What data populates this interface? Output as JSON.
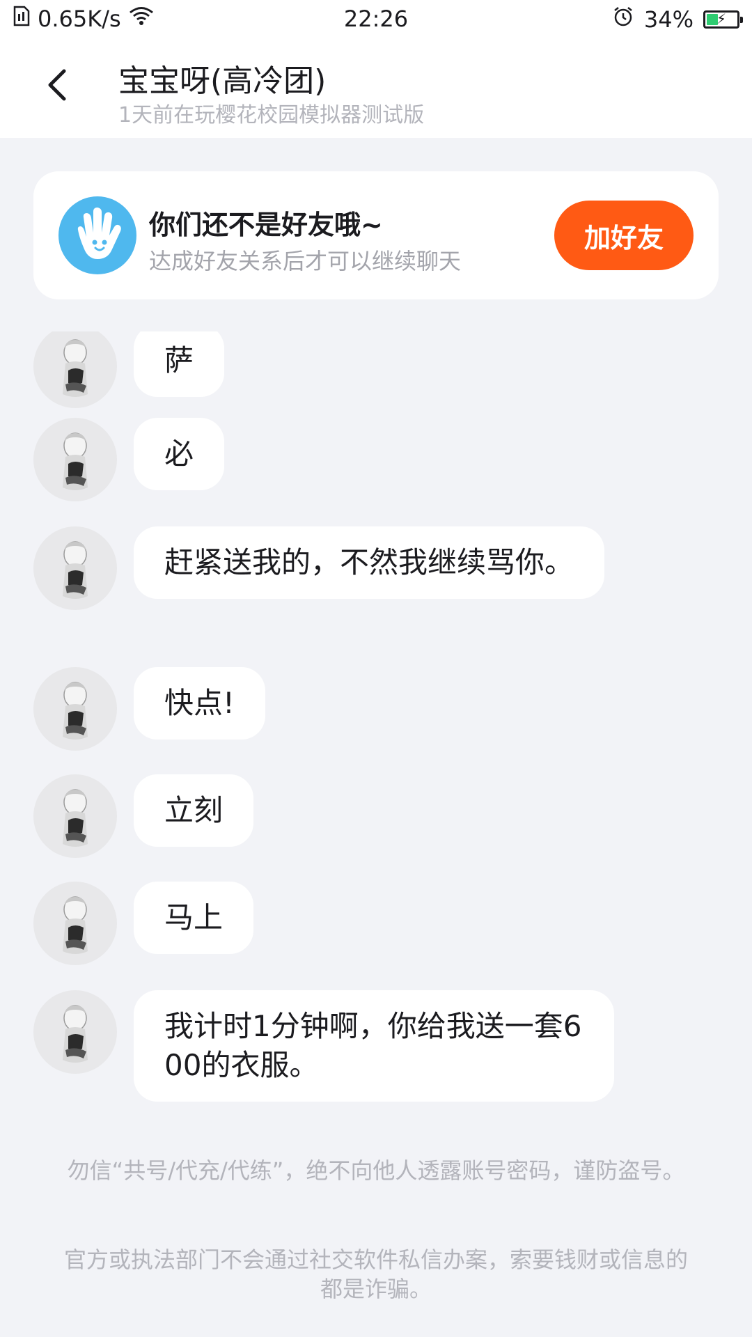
{
  "status_bar": {
    "network_speed": "0.65K/s",
    "time": "22:26",
    "battery_percent": "34%",
    "battery_level": 0.34,
    "icons": [
      "sim-icon",
      "wifi-icon",
      "alarm-icon",
      "battery-charging-icon"
    ]
  },
  "header": {
    "back_icon": "chevron-left-icon",
    "title": "宝宝呀(高冷团)",
    "subtitle": "1天前在玩樱花校园模拟器测试版"
  },
  "friend_notice": {
    "icon": "waving-hand-icon",
    "title": "你们还不是好友哦~",
    "description": "达成好友关系后才可以继续聊天",
    "button_label": "加好友"
  },
  "messages": [
    {
      "text": "萨"
    },
    {
      "text": "必"
    },
    {
      "text": "赶紧送我的，不然我继续骂你。"
    },
    {
      "text": "快点!"
    },
    {
      "text": "立刻"
    },
    {
      "text": "马上"
    },
    {
      "text": "我计时1分钟啊，你给我送一套600的衣服。"
    }
  ],
  "notices": {
    "anti_fraud_1": "勿信“共号/代充/代练”，绝不向他人透露账号密码，谨防盗号。",
    "anti_fraud_2": "官方或执法部门不会通过社交软件私信办案，索要钱财或信息的都是诈骗。"
  },
  "colors": {
    "background": "#f2f3f7",
    "accent_button": "#ff5a14",
    "friend_icon_bg": "#4fb8ee",
    "battery_fill": "#2ecc71"
  }
}
